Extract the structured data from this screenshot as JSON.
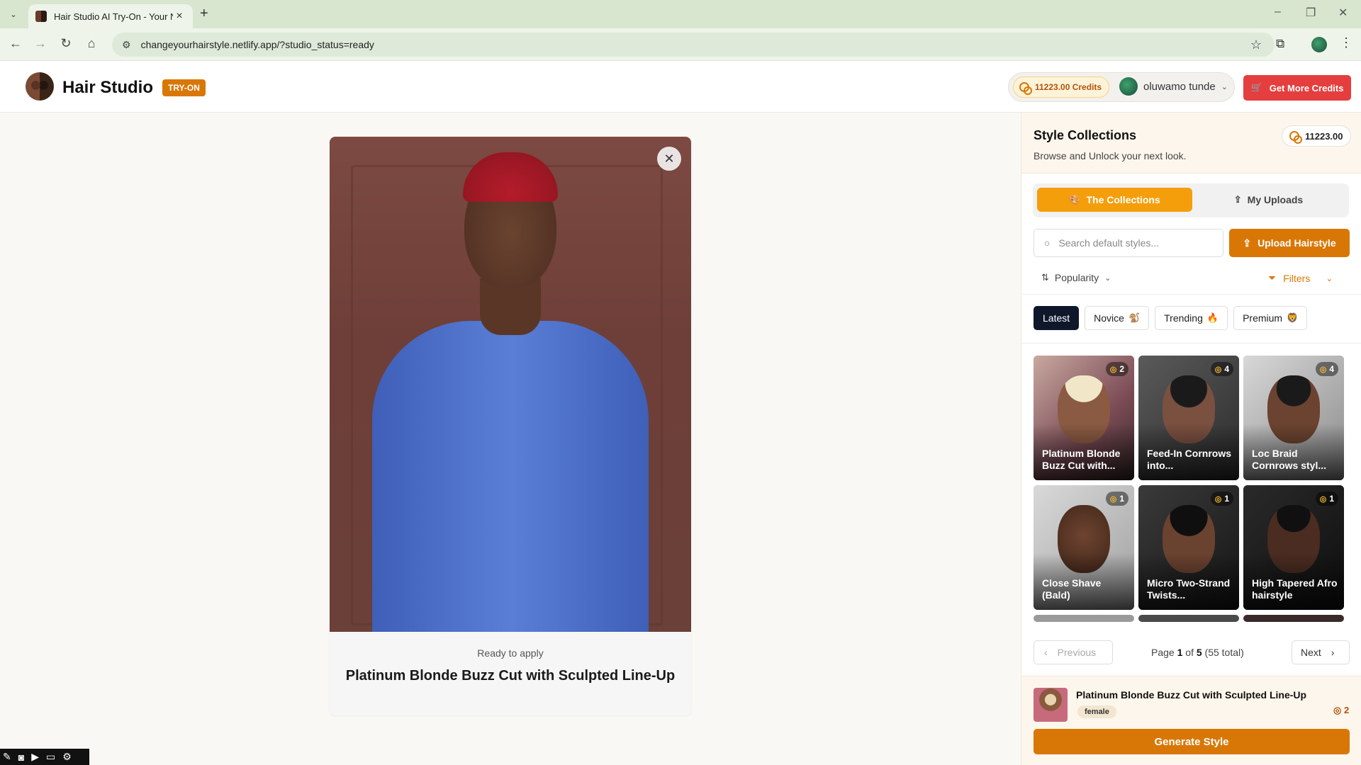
{
  "browser": {
    "tab_title": "Hair Studio AI Try-On - Your Ne",
    "url": "changeyourhairstyle.netlify.app/?studio_status=ready"
  },
  "header": {
    "brand": "Hair Studio",
    "badge": "TRY-ON",
    "credits": "11223.00 Credits",
    "username": "oluwamo tunde",
    "get_more": "Get More Credits"
  },
  "preview": {
    "status": "Ready to apply",
    "style_name": "Platinum Blonde Buzz Cut with Sculpted Line-Up"
  },
  "panel": {
    "title": "Style Collections",
    "subtitle": "Browse and Unlock your next look.",
    "credits": "11223.00",
    "tabs": [
      "The Collections",
      "My Uploads"
    ],
    "search_placeholder": "Search default styles...",
    "upload_label": "Upload Hairstyle",
    "sort_label": "Popularity",
    "filters_label": "Filters",
    "chips": [
      {
        "label": "Latest",
        "emoji": ""
      },
      {
        "label": "Novice",
        "emoji": "🐒"
      },
      {
        "label": "Trending",
        "emoji": "🔥"
      },
      {
        "label": "Premium",
        "emoji": "🦁"
      }
    ],
    "styles": [
      {
        "name": "Platinum Blonde Buzz Cut with...",
        "cost": "2"
      },
      {
        "name": "Feed-In Cornrows into...",
        "cost": "4"
      },
      {
        "name": "Loc Braid Cornrows styl...",
        "cost": "4"
      },
      {
        "name": "Close Shave (Bald)",
        "cost": "1"
      },
      {
        "name": "Micro Two-Strand Twists...",
        "cost": "1"
      },
      {
        "name": "High Tapered Afro hairstyle",
        "cost": "1"
      }
    ],
    "pager": {
      "previous": "Previous",
      "next": "Next",
      "page_prefix": "Page",
      "page": "1",
      "of": "of",
      "total_pages": "5",
      "total": "(55 total)"
    },
    "selected": {
      "name": "Platinum Blonde Buzz Cut with Sculpted Line-Up",
      "tag": "female",
      "cost": "2",
      "generate": "Generate Style"
    }
  },
  "colors": {
    "accent": "#d97706",
    "accent_light": "#f59e0b",
    "danger": "#e53e3e",
    "dark_chip": "#0f172a"
  }
}
